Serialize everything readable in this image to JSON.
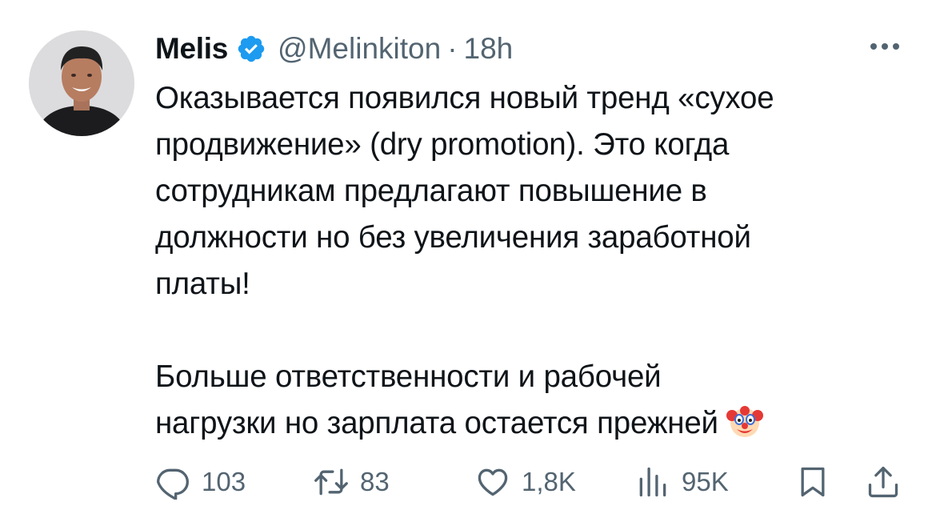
{
  "tweet": {
    "author": {
      "display_name": "Melis",
      "verified": true,
      "handle": "@Melinkiton",
      "separator": "·",
      "time": "18h"
    },
    "text_lines": [
      "Оказывается появился новый тренд «сухое",
      "продвижение» (dry promotion). Это когда",
      "сотрудникам предлагают повышение в",
      "должности но без увеличения заработной",
      "платы!",
      "",
      "Больше ответственности и рабочей",
      "нагрузки но зарплата остается прежней"
    ],
    "emoji": "🤡",
    "actions": {
      "replies": "103",
      "reposts": "83",
      "likes": "1,8K",
      "views": "95K"
    },
    "icons": {
      "more": "more-icon",
      "verified": "verified-badge-icon",
      "reply": "reply-icon",
      "repost": "repost-icon",
      "like": "like-icon",
      "views": "views-icon",
      "bookmark": "bookmark-icon",
      "share": "share-icon"
    },
    "colors": {
      "text": "#0f1419",
      "secondary": "#536471",
      "verified": "#1d9bf0",
      "background": "#ffffff"
    }
  }
}
